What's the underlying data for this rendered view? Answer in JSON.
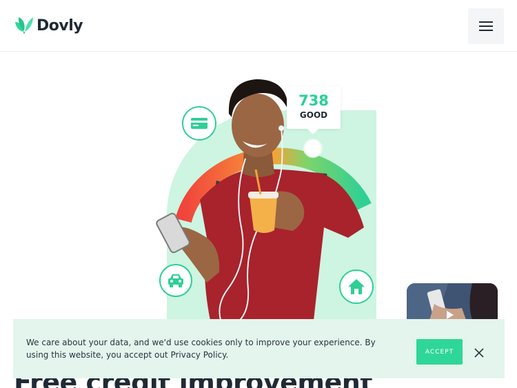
{
  "header": {
    "brand": "Dovly",
    "logo_icon": "leaf-logo-icon",
    "menu_icon": "hamburger-menu-icon"
  },
  "hero": {
    "score_value": "738",
    "score_label": "GOOD",
    "icons": [
      "credit-card-icon",
      "car-icon",
      "home-icon"
    ],
    "video_icon": "play-icon"
  },
  "headline": "Free credit improvement",
  "cookie": {
    "text": "We care about your data, and we'd use cookies only to improve your experience. By using this website, you accept out Privacy Policy.",
    "accept_label": "ACCEPT",
    "close_icon": "close-icon"
  },
  "colors": {
    "brand_green": "#2fd69a",
    "hero_bg": "#cdf5e2",
    "gauge_red": "#f0443c",
    "gauge_orange": "#f7a235",
    "gauge_green": "#2fcf95",
    "text_dark": "#1f2a34",
    "cookie_bg": "#e3f5ec",
    "shirt_red": "#a8232c"
  }
}
